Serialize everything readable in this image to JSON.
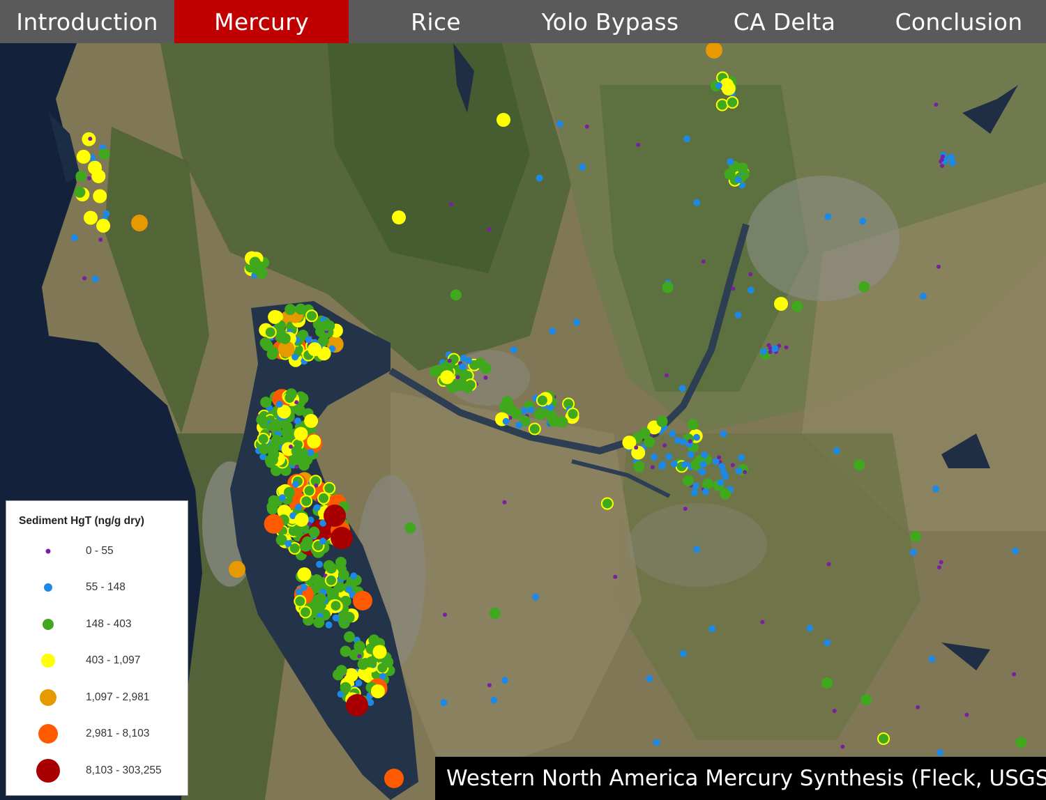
{
  "nav": {
    "tabs": [
      {
        "label": "Introduction",
        "active": false
      },
      {
        "label": "Mercury",
        "active": true
      },
      {
        "label": "Rice",
        "active": false
      },
      {
        "label": "Yolo Bypass",
        "active": false
      },
      {
        "label": "CA Delta",
        "active": false
      },
      {
        "label": "Conclusion",
        "active": false
      }
    ],
    "active_color": "#c00000",
    "bar_color": "#5a5a5a"
  },
  "legend": {
    "title": "Sediment HgT (ng/g dry)",
    "classes": [
      {
        "label": "0 - 55",
        "color": "#7a1fa2"
      },
      {
        "label": "55 - 148",
        "color": "#1e88e5"
      },
      {
        "label": "148 - 403",
        "color": "#3fa81c"
      },
      {
        "label": "403 - 1,097",
        "color": "#ffff00"
      },
      {
        "label": "1,097 - 2,981",
        "color": "#e69a00"
      },
      {
        "label": "2,981 - 8,103",
        "color": "#ff5a00"
      },
      {
        "label": "8,103 - 303,255",
        "color": "#a80000"
      }
    ]
  },
  "caption": "Western North America Mercury Synthesis (Fleck, USGS)",
  "map": {
    "basemap": "satellite imagery",
    "colors": {
      "ocean": "#13223a",
      "bay": "#23334a",
      "land": "#857c5d",
      "vegetation": "#3a5a2a",
      "urban": "#8a8a84"
    }
  }
}
